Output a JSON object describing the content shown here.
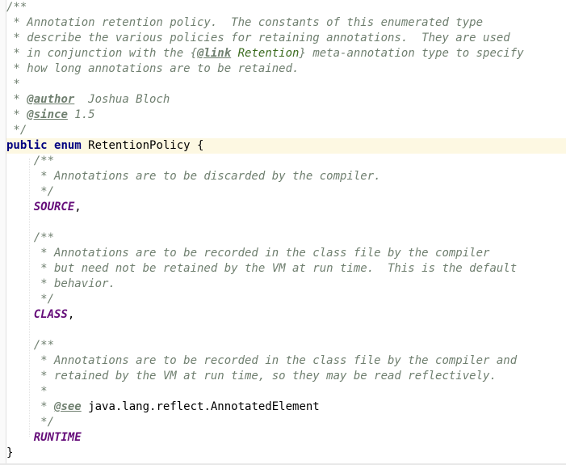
{
  "lines": [
    {
      "segments": [
        {
          "t": "/**",
          "k": "c"
        }
      ]
    },
    {
      "segments": [
        {
          "t": " * Annotation retention policy.  The constants of this enumerated type",
          "k": "c"
        }
      ]
    },
    {
      "segments": [
        {
          "t": " * describe the various policies for retaining annotations.  They are used",
          "k": "c"
        }
      ]
    },
    {
      "segments": [
        {
          "t": " * in conjunction with the {",
          "k": "c"
        },
        {
          "t": "@link",
          "k": "tag"
        },
        {
          "t": " Retention",
          "k": "ref"
        },
        {
          "t": "} meta-annotation type to specify",
          "k": "c"
        }
      ]
    },
    {
      "segments": [
        {
          "t": " * how long annotations are to be retained.",
          "k": "c"
        }
      ]
    },
    {
      "segments": [
        {
          "t": " *",
          "k": "c"
        }
      ]
    },
    {
      "segments": [
        {
          "t": " * ",
          "k": "c"
        },
        {
          "t": "@author",
          "k": "tag"
        },
        {
          "t": "  Joshua Bloch",
          "k": "c"
        }
      ]
    },
    {
      "segments": [
        {
          "t": " * ",
          "k": "c"
        },
        {
          "t": "@since",
          "k": "tag"
        },
        {
          "t": " 1.5",
          "k": "c"
        }
      ]
    },
    {
      "segments": [
        {
          "t": " */",
          "k": "c"
        }
      ]
    },
    {
      "segments": [
        {
          "t": "public",
          "k": "kw"
        },
        {
          "t": " ",
          "k": "plain"
        },
        {
          "t": "enum",
          "k": "kw"
        },
        {
          "t": " RetentionPolicy {",
          "k": "cls"
        }
      ],
      "current": true
    },
    {
      "segments": [
        {
          "t": "    /**",
          "k": "c"
        }
      ]
    },
    {
      "segments": [
        {
          "t": "     * Annotations are to be discarded by the compiler.",
          "k": "c"
        }
      ]
    },
    {
      "segments": [
        {
          "t": "     */",
          "k": "c"
        }
      ]
    },
    {
      "segments": [
        {
          "t": "    ",
          "k": "plain"
        },
        {
          "t": "SOURCE",
          "k": "const"
        },
        {
          "t": ",",
          "k": "plain"
        }
      ]
    },
    {
      "segments": [
        {
          "t": "",
          "k": "plain"
        }
      ]
    },
    {
      "segments": [
        {
          "t": "    /**",
          "k": "c"
        }
      ]
    },
    {
      "segments": [
        {
          "t": "     * Annotations are to be recorded in the class file by the compiler",
          "k": "c"
        }
      ]
    },
    {
      "segments": [
        {
          "t": "     * but need not be retained by the VM at run time.  This is the default",
          "k": "c"
        }
      ]
    },
    {
      "segments": [
        {
          "t": "     * behavior.",
          "k": "c"
        }
      ]
    },
    {
      "segments": [
        {
          "t": "     */",
          "k": "c"
        }
      ]
    },
    {
      "segments": [
        {
          "t": "    ",
          "k": "plain"
        },
        {
          "t": "CLASS",
          "k": "const"
        },
        {
          "t": ",",
          "k": "plain"
        }
      ]
    },
    {
      "segments": [
        {
          "t": "",
          "k": "plain"
        }
      ]
    },
    {
      "segments": [
        {
          "t": "    /**",
          "k": "c"
        }
      ]
    },
    {
      "segments": [
        {
          "t": "     * Annotations are to be recorded in the class file by the compiler and",
          "k": "c"
        }
      ]
    },
    {
      "segments": [
        {
          "t": "     * retained by the VM at run time, so they may be read reflectively.",
          "k": "c"
        }
      ]
    },
    {
      "segments": [
        {
          "t": "     *",
          "k": "c"
        }
      ]
    },
    {
      "segments": [
        {
          "t": "     * ",
          "k": "c"
        },
        {
          "t": "@see",
          "k": "tag"
        },
        {
          "t": " java.lang.reflect.AnnotatedElement",
          "k": "plain"
        }
      ]
    },
    {
      "segments": [
        {
          "t": "     */",
          "k": "c"
        }
      ]
    },
    {
      "segments": [
        {
          "t": "    ",
          "k": "plain"
        },
        {
          "t": "RUNTIME",
          "k": "const"
        }
      ]
    },
    {
      "segments": [
        {
          "t": "}",
          "k": "plain"
        }
      ]
    }
  ]
}
